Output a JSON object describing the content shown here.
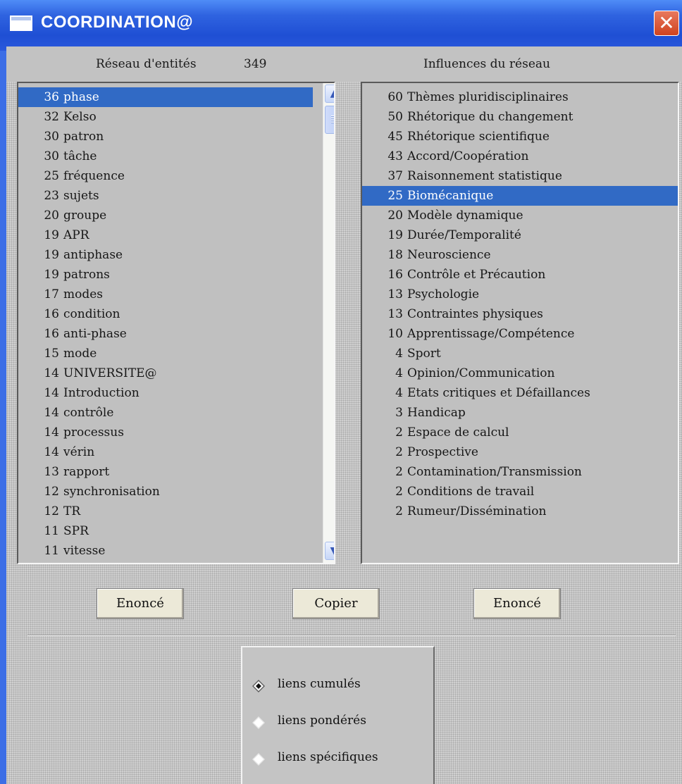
{
  "window": {
    "title": "COORDINATION@",
    "close_symbol": "✕"
  },
  "header": {
    "network_label": "Réseau d'entités",
    "network_count": "349",
    "influences_label": "Influences du réseau"
  },
  "left_list": {
    "items": [
      {
        "num": "36",
        "label": "phase",
        "selected": true
      },
      {
        "num": "32",
        "label": "Kelso"
      },
      {
        "num": "30",
        "label": "patron"
      },
      {
        "num": "30",
        "label": "tâche"
      },
      {
        "num": "25",
        "label": "fréquence"
      },
      {
        "num": "23",
        "label": "sujets"
      },
      {
        "num": "20",
        "label": "groupe"
      },
      {
        "num": "19",
        "label": "APR"
      },
      {
        "num": "19",
        "label": "antiphase"
      },
      {
        "num": "19",
        "label": "patrons"
      },
      {
        "num": "17",
        "label": "modes"
      },
      {
        "num": "16",
        "label": "condition"
      },
      {
        "num": "16",
        "label": "anti-phase"
      },
      {
        "num": "15",
        "label": "mode"
      },
      {
        "num": "14",
        "label": "UNIVERSITE@"
      },
      {
        "num": "14",
        "label": "Introduction"
      },
      {
        "num": "14",
        "label": "contrôle"
      },
      {
        "num": "14",
        "label": "processus"
      },
      {
        "num": "14",
        "label": "vérin"
      },
      {
        "num": "13",
        "label": "rapport"
      },
      {
        "num": "12",
        "label": "synchronisation"
      },
      {
        "num": "12",
        "label": "TR"
      },
      {
        "num": "11",
        "label": "SPR"
      },
      {
        "num": "11",
        "label": "vitesse"
      }
    ],
    "scroll_up_symbol": "▲",
    "scroll_down_symbol": "▼"
  },
  "right_list": {
    "items": [
      {
        "num": "60",
        "label": "Thèmes pluridisciplinaires"
      },
      {
        "num": "50",
        "label": "Rhétorique du changement"
      },
      {
        "num": "45",
        "label": "Rhétorique scientifique"
      },
      {
        "num": "43",
        "label": "Accord/Coopération"
      },
      {
        "num": "37",
        "label": "Raisonnement statistique"
      },
      {
        "num": "25",
        "label": "Biomécanique",
        "selected": true
      },
      {
        "num": "20",
        "label": "Modèle dynamique"
      },
      {
        "num": "19",
        "label": "Durée/Temporalité"
      },
      {
        "num": "18",
        "label": "Neuroscience"
      },
      {
        "num": "16",
        "label": "Contrôle et Précaution"
      },
      {
        "num": "13",
        "label": "Psychologie"
      },
      {
        "num": "13",
        "label": "Contraintes physiques"
      },
      {
        "num": "10",
        "label": "Apprentissage/Compétence"
      },
      {
        "num": "4",
        "label": "Sport"
      },
      {
        "num": "4",
        "label": "Opinion/Communication"
      },
      {
        "num": "4",
        "label": "Etats critiques et Défaillances"
      },
      {
        "num": "3",
        "label": "Handicap"
      },
      {
        "num": "2",
        "label": "Espace de calcul"
      },
      {
        "num": "2",
        "label": "Prospective"
      },
      {
        "num": "2",
        "label": "Contamination/Transmission"
      },
      {
        "num": "2",
        "label": "Conditions de travail"
      },
      {
        "num": "2",
        "label": "Rumeur/Dissémination"
      }
    ]
  },
  "buttons": {
    "left": "Enoncé",
    "center": "Copier",
    "right": "Enoncé"
  },
  "radio_group": {
    "options": [
      {
        "label": "liens cumulés",
        "checked": true
      },
      {
        "label": "liens pondérés",
        "checked": false
      },
      {
        "label": "liens spécifiques",
        "checked": false
      }
    ]
  },
  "colors": {
    "selection": "#316ac5",
    "titlebar": "#1f4fd4",
    "list_background": "#c0c0c0",
    "button_face": "#ece9d8"
  }
}
